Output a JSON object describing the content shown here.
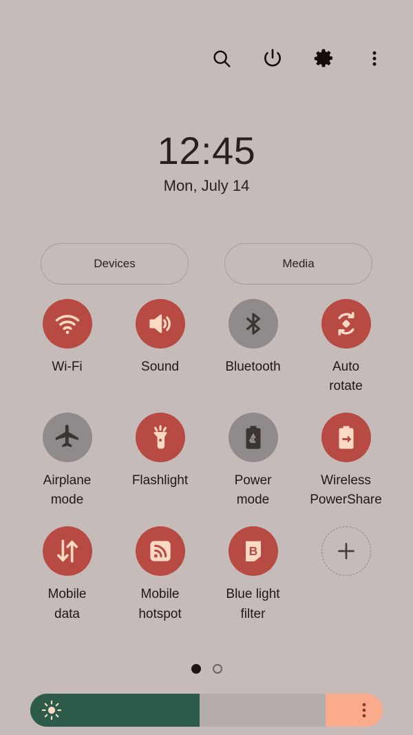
{
  "panel": {
    "background_color": "#c5bcba",
    "accent_on_color": "#b84a44",
    "accent_off_color": "#8e8b8a",
    "icon_fg_color": "#fbd9c3"
  },
  "topbar": {
    "icons": [
      {
        "name": "search-icon",
        "label": "Search"
      },
      {
        "name": "power-icon",
        "label": "Power off"
      },
      {
        "name": "gear-icon",
        "label": "Settings"
      },
      {
        "name": "more-options-icon",
        "label": "More options"
      }
    ]
  },
  "clock": {
    "time": "12:45",
    "date": "Mon, July 14"
  },
  "shortcuts": {
    "devices_label": "Devices",
    "media_label": "Media"
  },
  "toggles": [
    {
      "label": "Wi-Fi",
      "icon": "wifi-icon",
      "state": "on"
    },
    {
      "label": "Sound",
      "icon": "sound-icon",
      "state": "on"
    },
    {
      "label": "Bluetooth",
      "icon": "bluetooth-icon",
      "state": "off"
    },
    {
      "label": "Auto\nrotate",
      "icon": "auto-rotate-icon",
      "state": "on"
    },
    {
      "label": "Airplane\nmode",
      "icon": "airplane-icon",
      "state": "off"
    },
    {
      "label": "Flashlight",
      "icon": "flashlight-icon",
      "state": "on"
    },
    {
      "label": "Power\nmode",
      "icon": "power-mode-icon",
      "state": "off"
    },
    {
      "label": "Wireless\nPowerShare",
      "icon": "power-share-icon",
      "state": "on"
    },
    {
      "label": "Mobile\ndata",
      "icon": "mobile-data-icon",
      "state": "on"
    },
    {
      "label": "Mobile\nhotspot",
      "icon": "hotspot-icon",
      "state": "on"
    },
    {
      "label": "Blue light\nfilter",
      "icon": "blue-light-icon",
      "state": "on"
    },
    {
      "label": "",
      "icon": "add-icon",
      "state": "add"
    }
  ],
  "pagination": {
    "current_page": 1,
    "total_pages": 2
  },
  "brightness": {
    "level_percent": 48,
    "track_color": "#b5adab",
    "fill_color": "#2d5b49",
    "right_section_color": "#f9ab8c",
    "sun_icon": "brightness-sun-icon",
    "menu_icon": "brightness-options-icon"
  }
}
